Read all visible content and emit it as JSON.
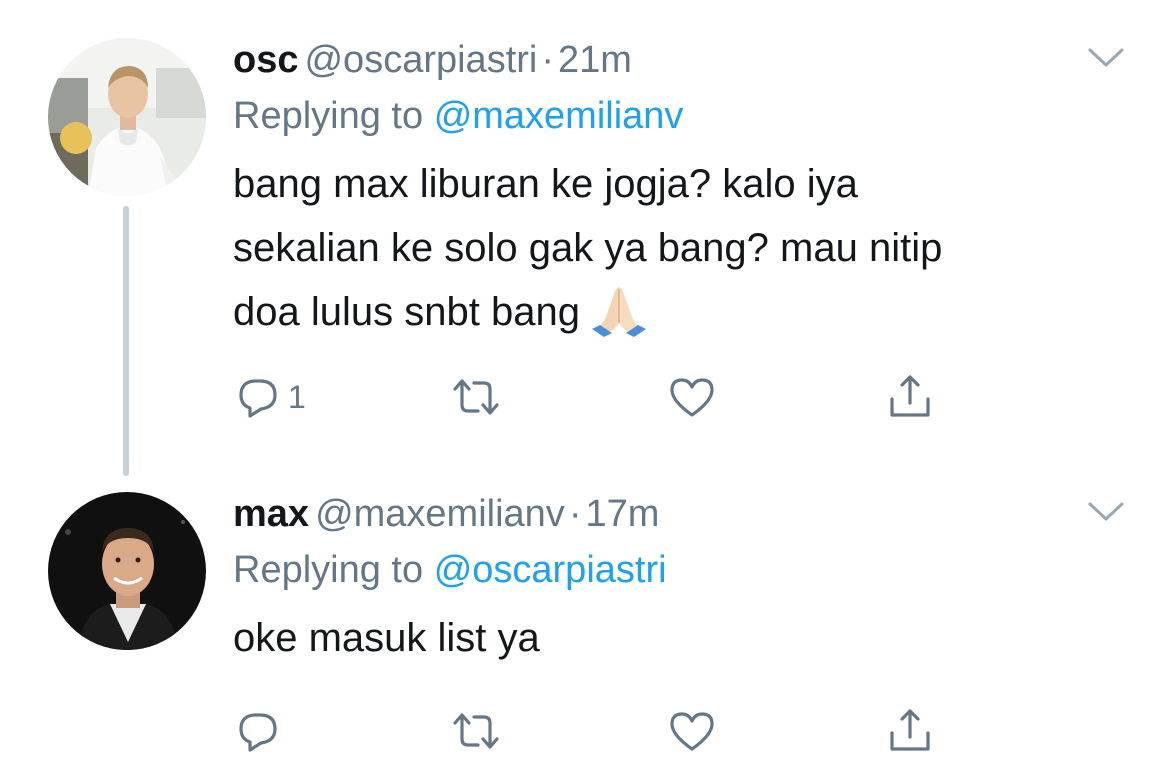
{
  "colors": {
    "text_primary": "#14171a",
    "text_secondary": "#657786",
    "link_blue": "#1da1f2",
    "thread_line": "#c4cfd6"
  },
  "tweets": [
    {
      "display_name": "osc",
      "handle": "@oscarpiastri",
      "separator": "·",
      "time": "21m",
      "replying_prefix": "Replying to",
      "replying_to": "@maxemilianv",
      "text_lines": [
        "bang max liburan ke jogja? kalo iya",
        "sekalian ke solo gak ya bang? mau nitip",
        "doa lulus snbt bang"
      ],
      "emoji": "folded-hands",
      "reply_count": "1",
      "avatar_icon": "profile-photo-osc"
    },
    {
      "display_name": "max",
      "handle": "@maxemilianv",
      "separator": "·",
      "time": "17m",
      "replying_prefix": "Replying to",
      "replying_to": "@oscarpiastri",
      "text_lines": [
        "oke masuk list ya"
      ],
      "reply_count": "",
      "avatar_icon": "profile-photo-max"
    }
  ],
  "icons": {
    "reply": "reply-icon",
    "retweet": "retweet-icon",
    "like": "like-icon",
    "share": "share-icon",
    "caret": "chevron-down-icon"
  }
}
